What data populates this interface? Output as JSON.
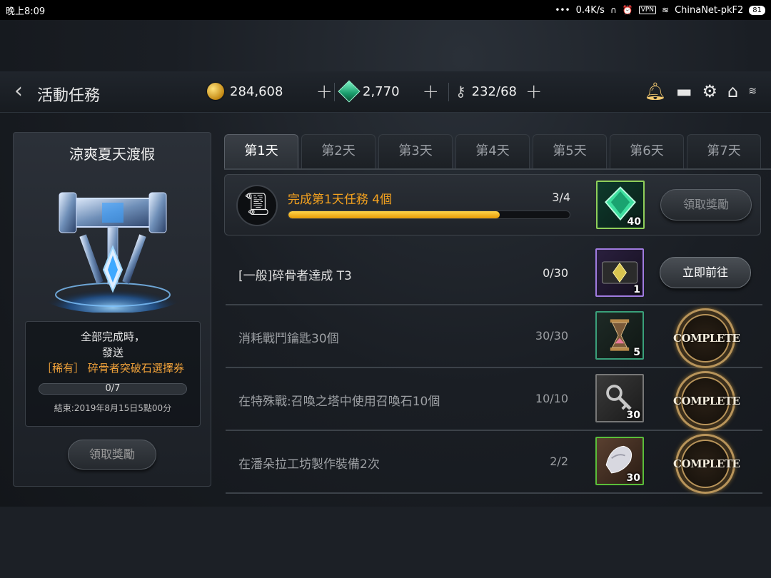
{
  "status_bar": {
    "time": "晚上8:09",
    "speed": "0.4K/s",
    "vpn": "VPN",
    "network": "ChinaNet-pkF2",
    "battery": "81"
  },
  "header": {
    "title": "活動任務",
    "gold": "284,608",
    "gems": "2,770",
    "keys": "232/68",
    "plus": "+"
  },
  "event": {
    "title": "涼爽夏天渡假",
    "reward_line1": "全部完成時，",
    "reward_line2": "發送",
    "reward_line3": "［稀有］ 碎骨者突破石選擇券",
    "progress": "0/7",
    "progress_fraction": 0,
    "end_time": "結束:2019年8月15日5點00分",
    "claim_label": "領取獎勵"
  },
  "tabs": [
    {
      "label": "第1天",
      "active": true
    },
    {
      "label": "第2天",
      "active": false
    },
    {
      "label": "第3天",
      "active": false
    },
    {
      "label": "第4天",
      "active": false
    },
    {
      "label": "第5天",
      "active": false
    },
    {
      "label": "第6天",
      "active": false
    },
    {
      "label": "第7天",
      "active": false
    }
  ],
  "summary": {
    "label": "完成第1天任務  4個",
    "count": "3/4",
    "progress_fraction": 0.75,
    "reward_qty": "40",
    "claim_label": "領取獎勵"
  },
  "missions": [
    {
      "label": "[一般]碎骨者達成 T3",
      "count": "0/30",
      "reward_qty": "1",
      "action": "立即前往",
      "done": false
    },
    {
      "label": "消耗戰鬥鑰匙30個",
      "count": "30/30",
      "reward_qty": "5",
      "action": "COMPLETE",
      "done": true
    },
    {
      "label": "在特殊戰:召喚之塔中使用召喚石10個",
      "count": "10/10",
      "reward_qty": "30",
      "action": "COMPLETE",
      "done": true
    },
    {
      "label": "在潘朵拉工坊製作裝備2次",
      "count": "2/2",
      "reward_qty": "30",
      "action": "COMPLETE",
      "done": true
    }
  ],
  "colors": {
    "accent_orange": "#f4a21f",
    "progress_yellow": "#ffd54a",
    "rare_text": "#f2a33a"
  }
}
